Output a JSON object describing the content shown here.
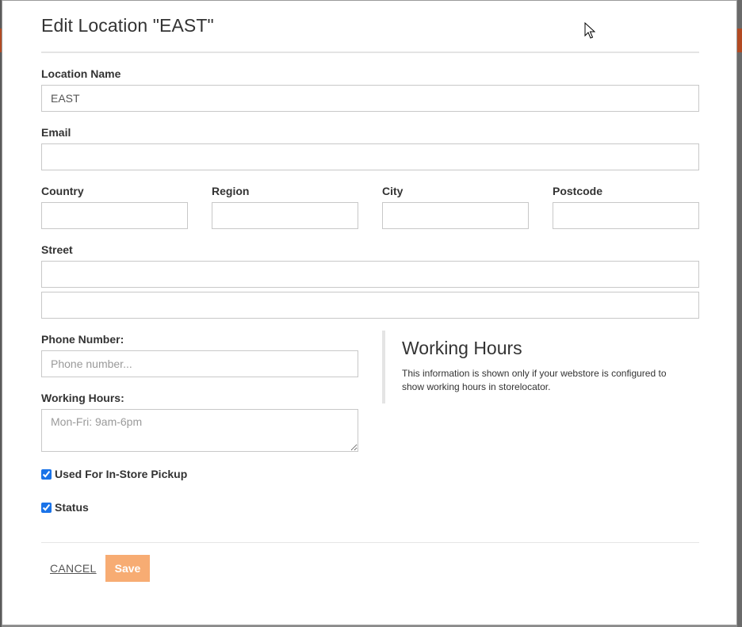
{
  "dialog": {
    "title": "Edit Location \"EAST\""
  },
  "form": {
    "location_name": {
      "label": "Location Name",
      "value": "EAST"
    },
    "email": {
      "label": "Email",
      "value": ""
    },
    "country": {
      "label": "Country",
      "value": ""
    },
    "region": {
      "label": "Region",
      "value": ""
    },
    "city": {
      "label": "City",
      "value": ""
    },
    "postcode": {
      "label": "Postcode",
      "value": ""
    },
    "street": {
      "label": "Street",
      "line1": "",
      "line2": ""
    },
    "phone": {
      "label": "Phone Number:",
      "placeholder": "Phone number..."
    },
    "working_hours": {
      "label": "Working Hours:",
      "placeholder": "Mon-Fri: 9am-6pm"
    },
    "in_store_pickup": {
      "label": "Used For In-Store Pickup",
      "checked": true
    },
    "status": {
      "label": "Status",
      "checked": true
    }
  },
  "info": {
    "title": "Working Hours",
    "text": "This information is shown only if your webstore is configured to show working hours in storelocator."
  },
  "actions": {
    "cancel_label": "CANCEL",
    "save_label": "Save"
  },
  "colors": {
    "save_button": "#f7ac73",
    "checkbox_accent": "#1a73e8",
    "backdrop_accent": "#b24a22"
  }
}
